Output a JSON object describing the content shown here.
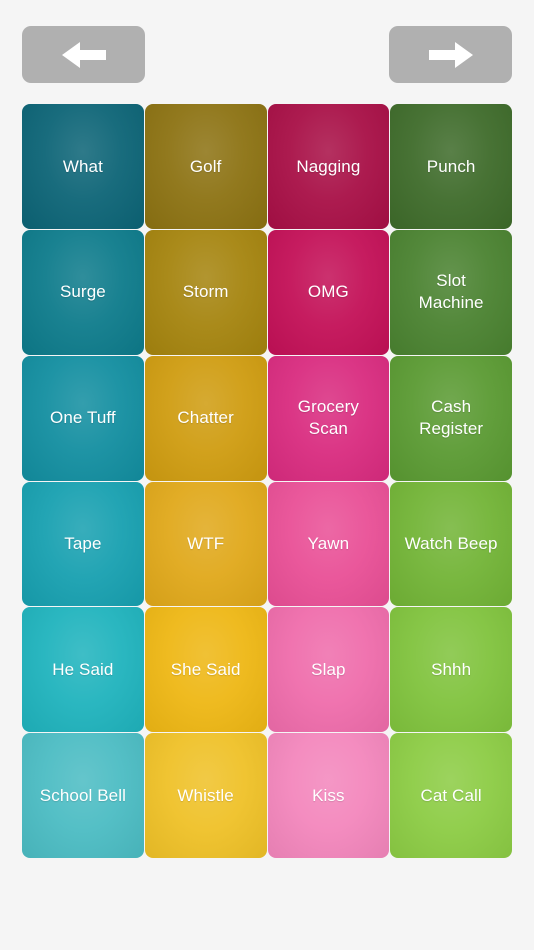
{
  "app": {
    "background_color": "#f5f5f5",
    "title": "Soundboard"
  },
  "navigation": {
    "prev": {
      "label": "Previous page",
      "icon": "arrow-left-icon",
      "color": "#b0b0b0",
      "arrow_color": "#ffffff"
    },
    "next": {
      "label": "Next page",
      "icon": "arrow-right-icon",
      "color": "#b0b0b0",
      "arrow_color": "#ffffff"
    }
  },
  "grid": {
    "columns": 4,
    "rows": 6,
    "text_color": "#ffffff",
    "tiles": [
      {
        "label": "What",
        "color": "#0c6476"
      },
      {
        "label": "Golf",
        "color": "#8c7212"
      },
      {
        "label": "Nagging",
        "color": "#a80f46"
      },
      {
        "label": "Punch",
        "color": "#3e6b2a"
      },
      {
        "label": "Surge",
        "color": "#0d7b8b"
      },
      {
        "label": "Storm",
        "color": "#a5840e"
      },
      {
        "label": "OMG",
        "color": "#c31057"
      },
      {
        "label": "Slot\nMachine",
        "color": "#4a8230"
      },
      {
        "label": "One Tuff",
        "color": "#128ea0"
      },
      {
        "label": "Chatter",
        "color": "#cf9c10"
      },
      {
        "label": "Grocery\nScan",
        "color": "#d92b7f"
      },
      {
        "label": "Cash\nRegister",
        "color": "#5a9a32"
      },
      {
        "label": "Tape",
        "color": "#17a0b0"
      },
      {
        "label": "WTF",
        "color": "#e0a81a"
      },
      {
        "label": "Yawn",
        "color": "#e94f96"
      },
      {
        "label": "Watch Beep",
        "color": "#72b436"
      },
      {
        "label": "He Said",
        "color": "#1fb3bd"
      },
      {
        "label": "She Said",
        "color": "#eeb714"
      },
      {
        "label": "Slap",
        "color": "#ef6cab"
      },
      {
        "label": "Shhh",
        "color": "#80c33d"
      },
      {
        "label": "School Bell",
        "color": "#4bbcc3"
      },
      {
        "label": "Whistle",
        "color": "#efc127"
      },
      {
        "label": "Kiss",
        "color": "#f386bc"
      },
      {
        "label": "Cat Call",
        "color": "#8ccc44"
      }
    ]
  }
}
